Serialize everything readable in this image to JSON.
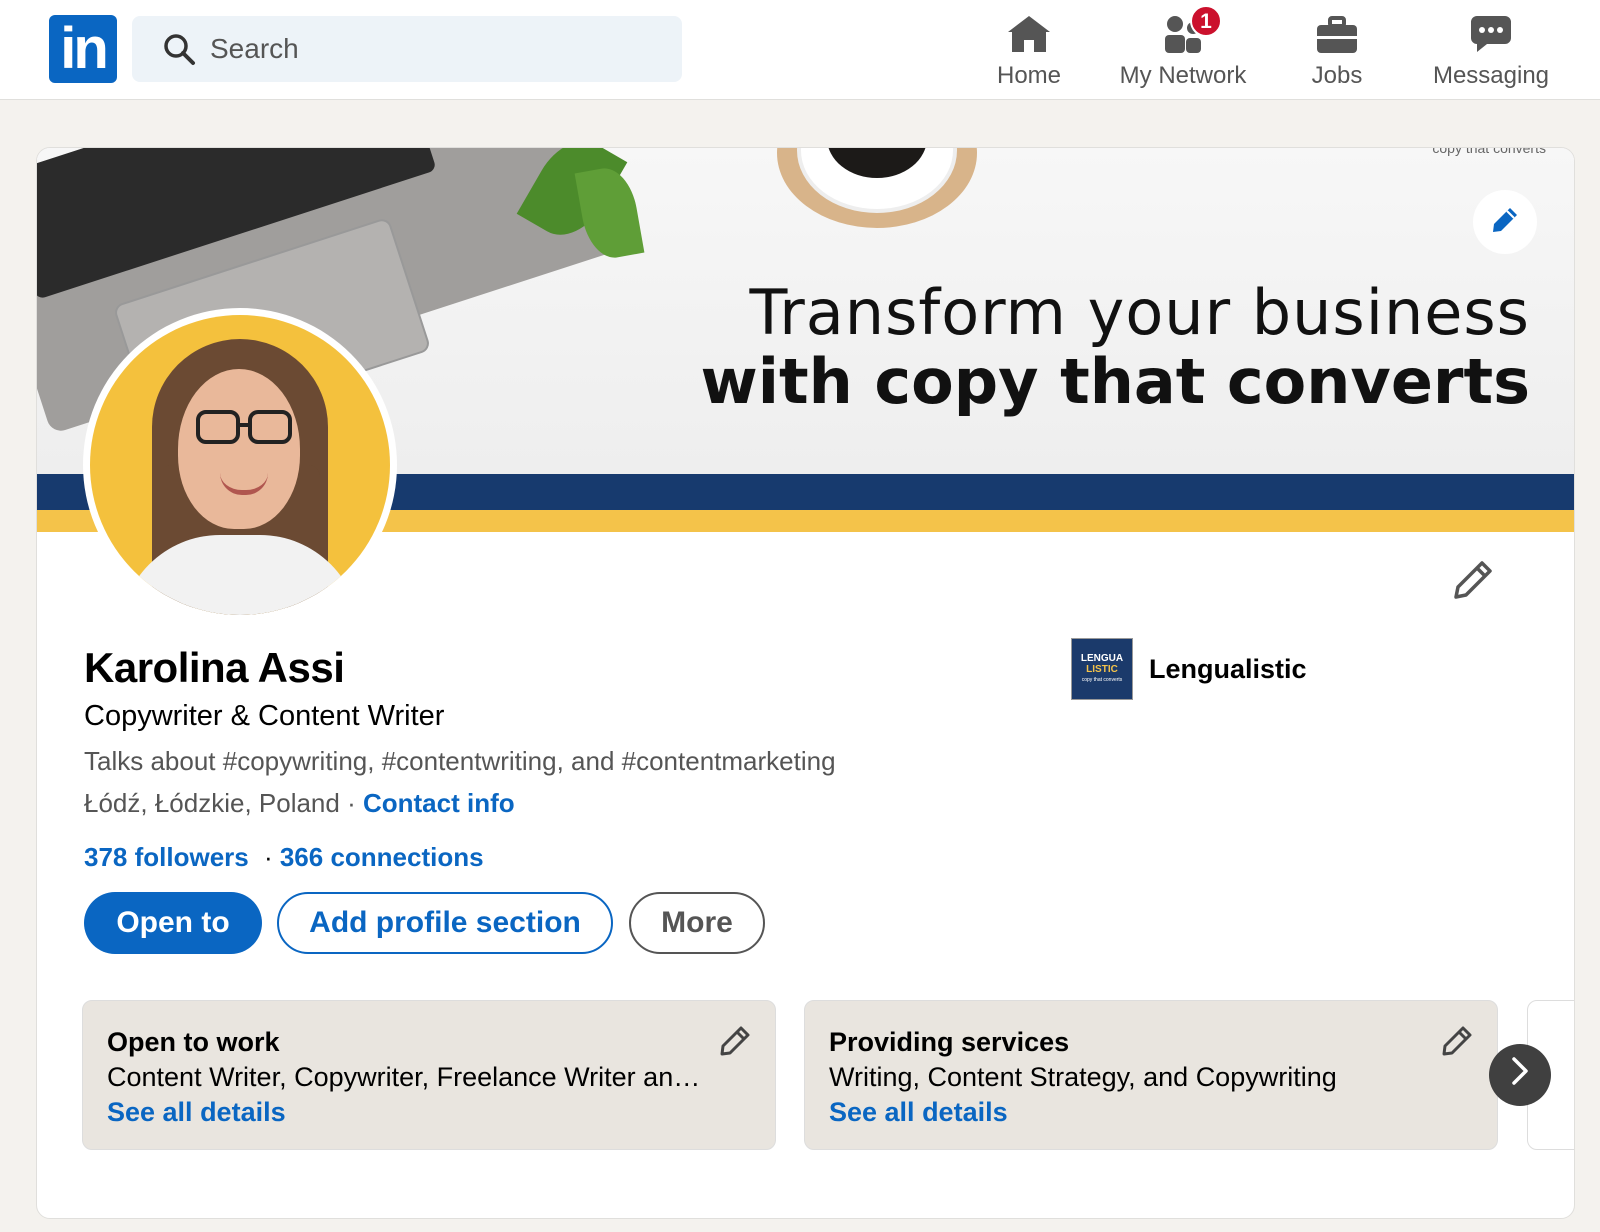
{
  "nav": {
    "search_placeholder": "Search",
    "items": [
      {
        "label": "Home",
        "icon": "home-icon"
      },
      {
        "label": "My Network",
        "icon": "people-icon",
        "badge": "1"
      },
      {
        "label": "Jobs",
        "icon": "briefcase-icon"
      },
      {
        "label": "Messaging",
        "icon": "chat-icon"
      }
    ]
  },
  "banner": {
    "small_text": "copy that converts",
    "line1": "Transform your business",
    "line2": "with copy that converts"
  },
  "profile": {
    "name": "Karolina Assi",
    "headline": "Copywriter & Content Writer",
    "talks": "Talks about #copywriting, #contentwriting, and #contentmarketing",
    "location": "Łódź, Łódzkie, Poland",
    "location_sep": " · ",
    "contact_label": "Contact info",
    "followers": "378 followers",
    "connections": "366 connections",
    "stats_sep": " · "
  },
  "company": {
    "name": "Lengualistic",
    "logo_line1": "LENGUA",
    "logo_line2": "LISTIC",
    "logo_line3": "copy that converts"
  },
  "actions": {
    "open_to": "Open to",
    "add_section": "Add profile section",
    "more": "More"
  },
  "cards": [
    {
      "title": "Open to work",
      "desc": "Content Writer, Copywriter, Freelance Writer and more",
      "link": "See all details"
    },
    {
      "title": "Providing services",
      "desc": "Writing, Content Strategy, and Copywriting",
      "link": "See all details"
    }
  ],
  "colors": {
    "brand": "#0a66c2",
    "badge": "#cb112d",
    "stripe_blue": "#173a6e",
    "stripe_yellow": "#f4c34a"
  }
}
